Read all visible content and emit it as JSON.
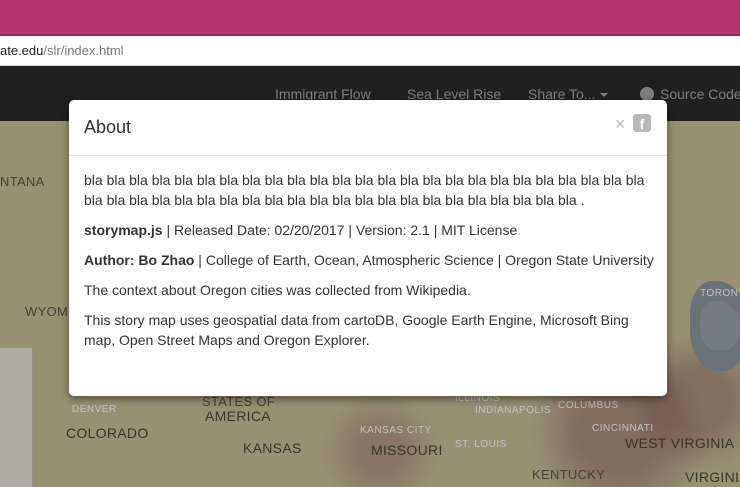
{
  "browser": {
    "url_host": "ate.edu",
    "url_path": "/slr/index.html"
  },
  "navbar": {
    "items": [
      {
        "label": "Immigrant Flow"
      },
      {
        "label": "Sea Level Rise"
      },
      {
        "label": "Share To..."
      },
      {
        "label": "Source Code"
      }
    ]
  },
  "map": {
    "labels": [
      "NTANA",
      "WYOMI",
      "COLORADO",
      "KANSAS",
      "MISSOURI",
      "KENTUCKY",
      "WEST VIRGINIA",
      "VIRGINIA",
      "STATES OF",
      "AMERICA",
      "DENVER",
      "ILLINOIS",
      "INDIANAPOLIS",
      "CINCINNATI",
      "ST. LOUIS",
      "KANSAS CITY",
      "COLUMBUS",
      "TORONTO"
    ]
  },
  "modal": {
    "title": "About",
    "close_label": "×",
    "facebook_icon": "f",
    "description": "bla bla bla bla bla bla bla bla bla bla bla bla bla bla bla bla bla bla bla bla bla bla bla bla bla bla bla bla bla bla bla bla bla bla bla bla bla bla bla bla bla bla bla bla bla bla bla .",
    "lib_name": "storymap.js",
    "lib_meta": " | Released Date: 02/20/2017 | Version: 2.1 | MIT License",
    "author_label": "Author: Bo Zhao",
    "author_affil": " | College of Earth, Ocean, Atmospheric Science | Oregon State University",
    "context": "The context about Oregon cities was collected from Wikipedia.",
    "data_sources": "This story map uses geospatial data from cartoDB, Google Earth Engine, Microsoft Bing map, Open Street Maps and Oregon Explorer."
  },
  "colors": {
    "titlebar": "#b5356f",
    "navbar": "#2b2b2b",
    "map_land": "#c9c297"
  }
}
